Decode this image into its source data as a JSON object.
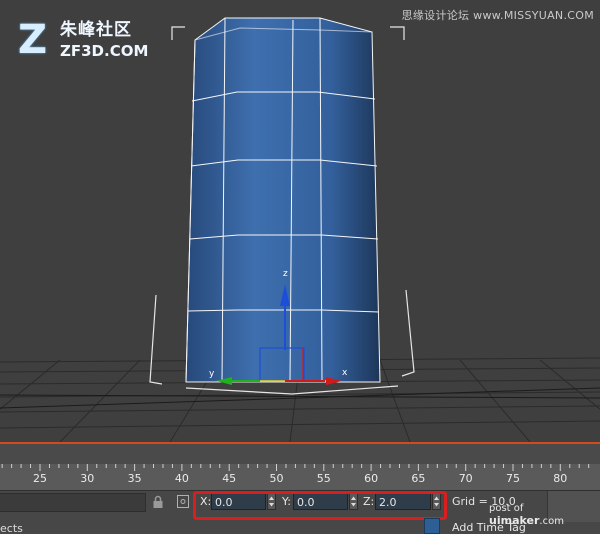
{
  "logo": {
    "mark": "Z",
    "name_cn": "朱峰社区",
    "name_en": "ZF3D.COM"
  },
  "watermark_top": "思缘设计论坛 www.MISSYUAN.COM",
  "viewport": {
    "axis_labels": {
      "z": "z",
      "x": "x",
      "y": "y"
    },
    "colors": {
      "cylinder": "#3a6aa8",
      "wireframe": "#ffffff",
      "background": "#3f3f3f",
      "grid": "#2a2a2a",
      "axis_x": "#d11b1b",
      "axis_y": "#1fb21f",
      "axis_z": "#1d4ed8"
    }
  },
  "timeline": {
    "ticks": [
      "25",
      "30",
      "35",
      "40",
      "45",
      "50",
      "55",
      "60",
      "65",
      "70",
      "75",
      "80"
    ],
    "accent": "#d24b1c"
  },
  "status": {
    "objects_text": "ects",
    "coords": {
      "x_label": "X:",
      "x_value": "0.0",
      "y_label": "Y:",
      "y_value": "0.0",
      "z_label": "Z:",
      "z_value": "2.0"
    },
    "grid": "Grid = 10.0",
    "add_time_tag": "Add Time Tag",
    "highlight_color": "#d81e1e"
  },
  "watermark_bottom": {
    "prefix": "post of ",
    "brand": "uimaker",
    "suffix": ".com"
  }
}
